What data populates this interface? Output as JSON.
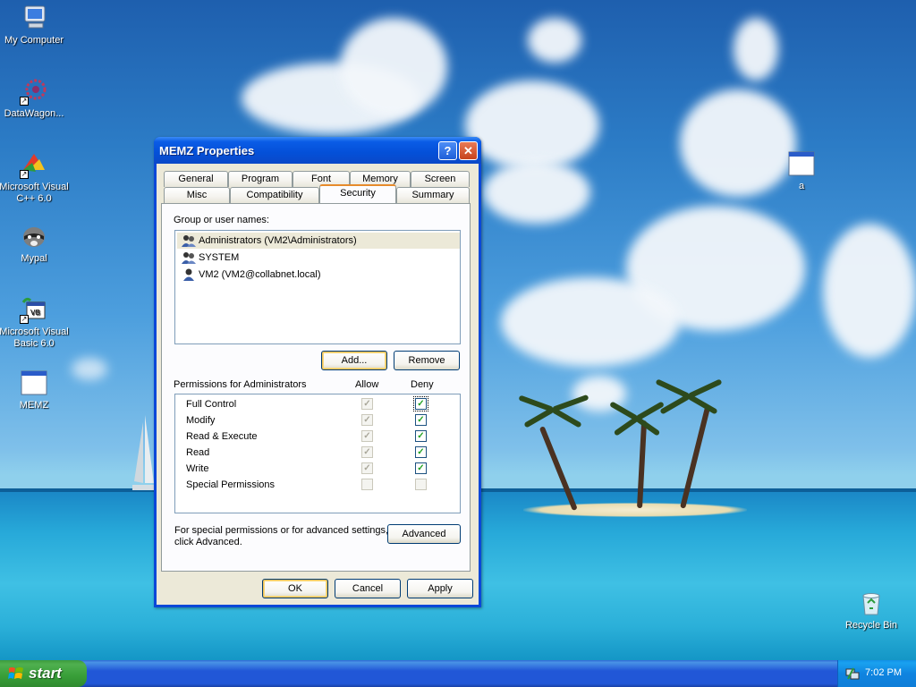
{
  "desktop": {
    "icons": [
      {
        "label": "My Computer"
      },
      {
        "label": "DataWagon..."
      },
      {
        "label": "Microsoft Visual C++ 6.0"
      },
      {
        "label": "Mypal"
      },
      {
        "label": "Microsoft Visual Basic 6.0"
      },
      {
        "label": "MEMZ"
      },
      {
        "label": "a"
      },
      {
        "label": "Recycle Bin"
      }
    ]
  },
  "dialog": {
    "title": "MEMZ Properties",
    "help_glyph": "?",
    "close_glyph": "✕",
    "tabs_back": [
      "General",
      "Program",
      "Font",
      "Memory",
      "Screen"
    ],
    "tabs_front": [
      "Misc",
      "Compatibility",
      "Security",
      "Summary"
    ],
    "active_tab": "Security",
    "group_label": "Group or user names:",
    "users": [
      {
        "name": "Administrators (VM2\\Administrators)",
        "selected": true
      },
      {
        "name": "SYSTEM",
        "selected": false
      },
      {
        "name": "VM2 (VM2@collabnet.local)",
        "selected": false
      }
    ],
    "add_button": "Add...",
    "remove_button": "Remove",
    "permissions_label": "Permissions for Administrators",
    "allow_header": "Allow",
    "deny_header": "Deny",
    "permissions": [
      {
        "name": "Full Control",
        "allow": true,
        "deny": true
      },
      {
        "name": "Modify",
        "allow": true,
        "deny": true
      },
      {
        "name": "Read & Execute",
        "allow": true,
        "deny": true
      },
      {
        "name": "Read",
        "allow": true,
        "deny": true
      },
      {
        "name": "Write",
        "allow": true,
        "deny": true
      },
      {
        "name": "Special Permissions",
        "allow": false,
        "deny": false
      }
    ],
    "advanced_text_line1": "For special permissions or for advanced settings,",
    "advanced_text_line2": "click Advanced.",
    "advanced_button": "Advanced",
    "ok_button": "OK",
    "cancel_button": "Cancel",
    "apply_button": "Apply"
  },
  "taskbar": {
    "start_label": "start",
    "clock": "7:02 PM"
  },
  "colors": {
    "titlebar": "#0a5ce6",
    "taskbar": "#2157d7",
    "start": "#389e38",
    "dialog_bg": "#ece9d8",
    "check_green": "#21a121"
  }
}
